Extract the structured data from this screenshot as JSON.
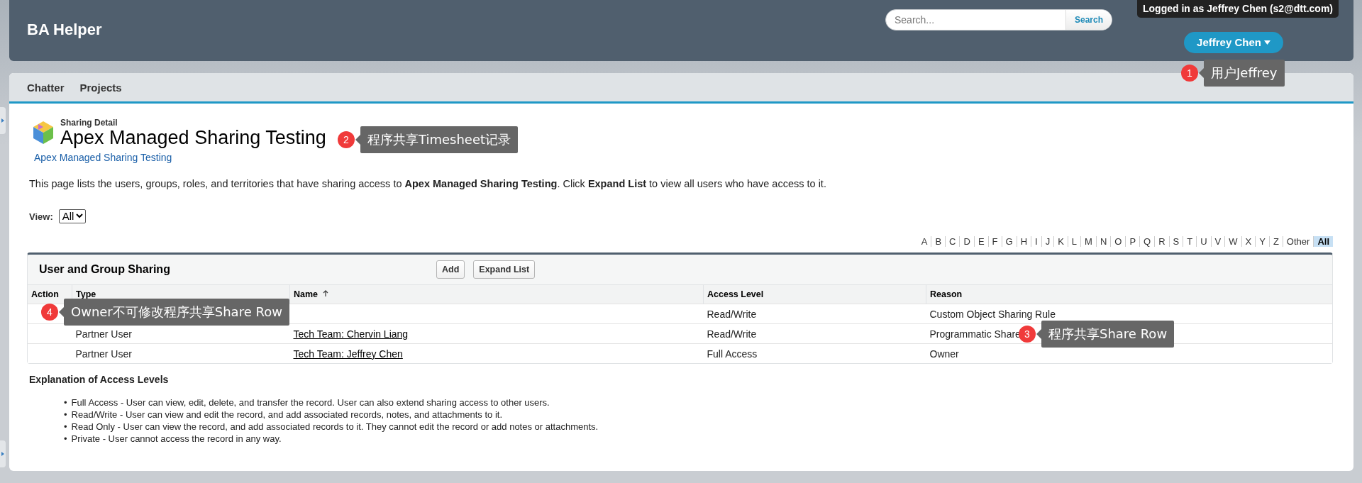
{
  "app": {
    "title": "BA Helper"
  },
  "search": {
    "placeholder": "Search...",
    "button": "Search"
  },
  "user": {
    "logged_in": "Logged in as Jeffrey Chen (s2@dtt.com)",
    "menu": "Jeffrey Chen"
  },
  "tabs": [
    {
      "label": "Chatter",
      "selected": false
    },
    {
      "label": "Projects",
      "selected": false
    }
  ],
  "page": {
    "eyebrow": "Sharing Detail",
    "title": "Apex Managed Sharing Testing",
    "breadcrumb": "Apex Managed Sharing Testing",
    "intro": "This page lists the users, groups, roles, and territories that have sharing access to **Apex Managed Sharing Testing**. Click **Expand List** to view all users who have access to it."
  },
  "view": {
    "label": "View:",
    "value": "All"
  },
  "alphabet": [
    {
      "label": "A",
      "selected": false
    },
    {
      "label": "B",
      "selected": false
    },
    {
      "label": "C",
      "selected": false
    },
    {
      "label": "D",
      "selected": false
    },
    {
      "label": "E",
      "selected": false
    },
    {
      "label": "F",
      "selected": false
    },
    {
      "label": "G",
      "selected": false
    },
    {
      "label": "H",
      "selected": false
    },
    {
      "label": "I",
      "selected": false
    },
    {
      "label": "J",
      "selected": false
    },
    {
      "label": "K",
      "selected": false
    },
    {
      "label": "L",
      "selected": false
    },
    {
      "label": "M",
      "selected": false
    },
    {
      "label": "N",
      "selected": false
    },
    {
      "label": "O",
      "selected": false
    },
    {
      "label": "P",
      "selected": false
    },
    {
      "label": "Q",
      "selected": false
    },
    {
      "label": "R",
      "selected": false
    },
    {
      "label": "S",
      "selected": false
    },
    {
      "label": "T",
      "selected": false
    },
    {
      "label": "U",
      "selected": false
    },
    {
      "label": "V",
      "selected": false
    },
    {
      "label": "W",
      "selected": false
    },
    {
      "label": "X",
      "selected": false
    },
    {
      "label": "Y",
      "selected": false
    },
    {
      "label": "Z",
      "selected": false
    },
    {
      "label": "Other",
      "selected": false
    },
    {
      "label": "All",
      "selected": true
    }
  ],
  "sharing": {
    "title": "User and Group Sharing",
    "buttons": [
      "Add",
      "Expand List"
    ],
    "columns": [
      {
        "label": "Action",
        "sorted": false
      },
      {
        "label": "Type",
        "sorted": false
      },
      {
        "label": "Name",
        "sorted": true
      },
      {
        "label": "Access Level",
        "sorted": false
      },
      {
        "label": "Reason",
        "sorted": false
      }
    ],
    "rows": [
      {
        "access": "Read/Write",
        "reason": "Custom Object Sharing Rule"
      },
      {
        "type": "Partner User",
        "name": "Tech Team: Chervin Liang",
        "access": "Read/Write",
        "reason": "Programmatic Share"
      },
      {
        "type": "Partner User",
        "name": "Tech Team: Jeffrey Chen",
        "access": "Full Access",
        "reason": "Owner"
      }
    ]
  },
  "explanation": {
    "title": "Explanation of Access Levels",
    "items": [
      {
        "bullet": "•",
        "text": "Full Access - User can view, edit, delete, and transfer the record. User can also extend sharing access to other users."
      },
      {
        "bullet": "•",
        "text": "Read/Write - User can view and edit the record, and add associated records, notes, and attachments to it."
      },
      {
        "bullet": "•",
        "text": "Read Only - User can view the record, and add associated records to it. They cannot edit the record or add notes or attachments."
      },
      {
        "bullet": "•",
        "text": "Private - User cannot access the record in any way."
      }
    ]
  },
  "annotations": [
    {
      "number": "1",
      "text": "用户Jeffrey"
    },
    {
      "number": "2",
      "text": "程序共享Timesheet记录"
    },
    {
      "number": "3",
      "text": "程序共享Share Row"
    },
    {
      "number": "4",
      "text": "Owner不可修改程序共享Share Row"
    }
  ]
}
